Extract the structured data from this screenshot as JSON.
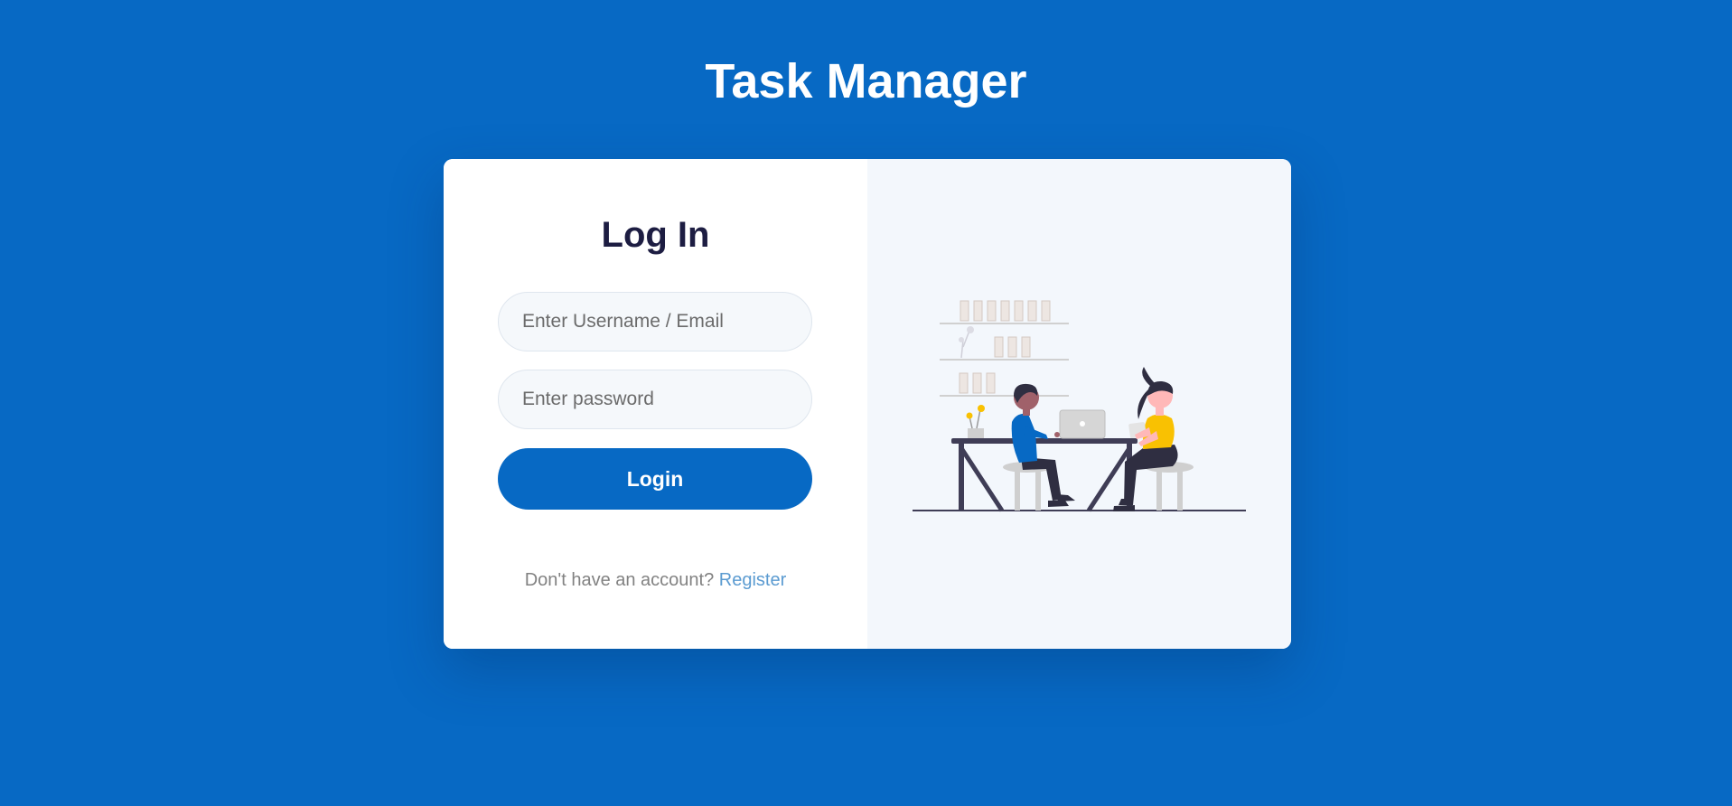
{
  "app": {
    "title": "Task Manager"
  },
  "login_form": {
    "heading": "Log In",
    "username_placeholder": "Enter Username / Email",
    "password_placeholder": "Enter password",
    "submit_label": "Login",
    "register_prompt": "Don't have an account?",
    "register_link": "Register"
  },
  "illustration": {
    "icon": "team-working-at-desk-illustration"
  },
  "colors": {
    "background": "#0769c4",
    "card": "#ffffff",
    "illustration_panel": "#f3f7fc",
    "heading_text": "#1d1d42",
    "link": "#5b9bd1",
    "accent_yellow": "#f9c102"
  }
}
